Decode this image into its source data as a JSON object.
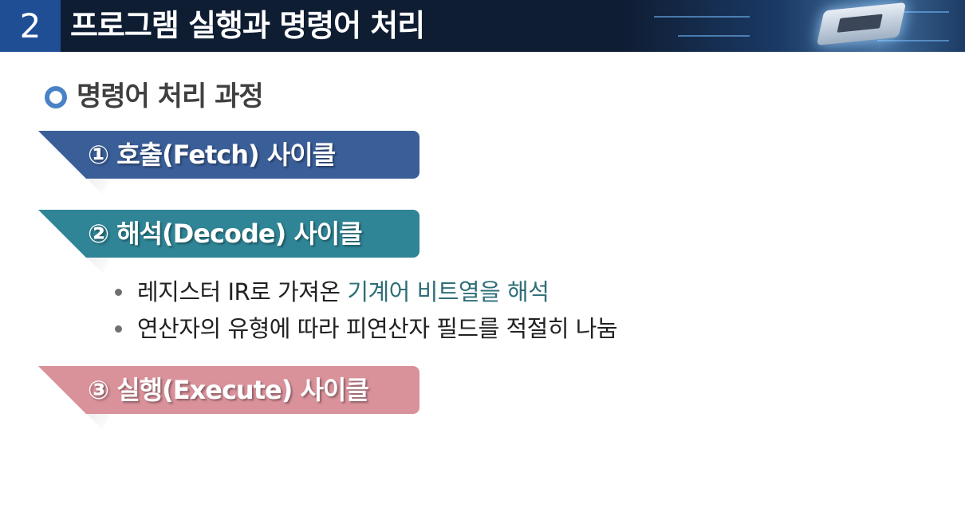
{
  "header": {
    "section_number": "2",
    "title": "프로그램 실행과 명령어 처리"
  },
  "subtitle": "명령어 처리 과정",
  "steps": [
    {
      "label": "① 호출(Fetch) 사이클",
      "color": "#3a5e98"
    },
    {
      "label": "② 해석(Decode) 사이클",
      "color": "#2f8495"
    },
    {
      "label": "③ 실행(Execute) 사이클",
      "color": "#d9919a"
    }
  ],
  "bullets": [
    {
      "text": "레지스터 IR로 가져온 ",
      "highlight": "기계어 비트열을 해석"
    },
    {
      "text": "연산자의 유형에 따라 피연산자 필드를 적절히 나눔"
    }
  ],
  "colors": {
    "header_bg": "#0f1d33",
    "section_badge": "#1f4e95",
    "highlight_text": "#2e6e78"
  }
}
